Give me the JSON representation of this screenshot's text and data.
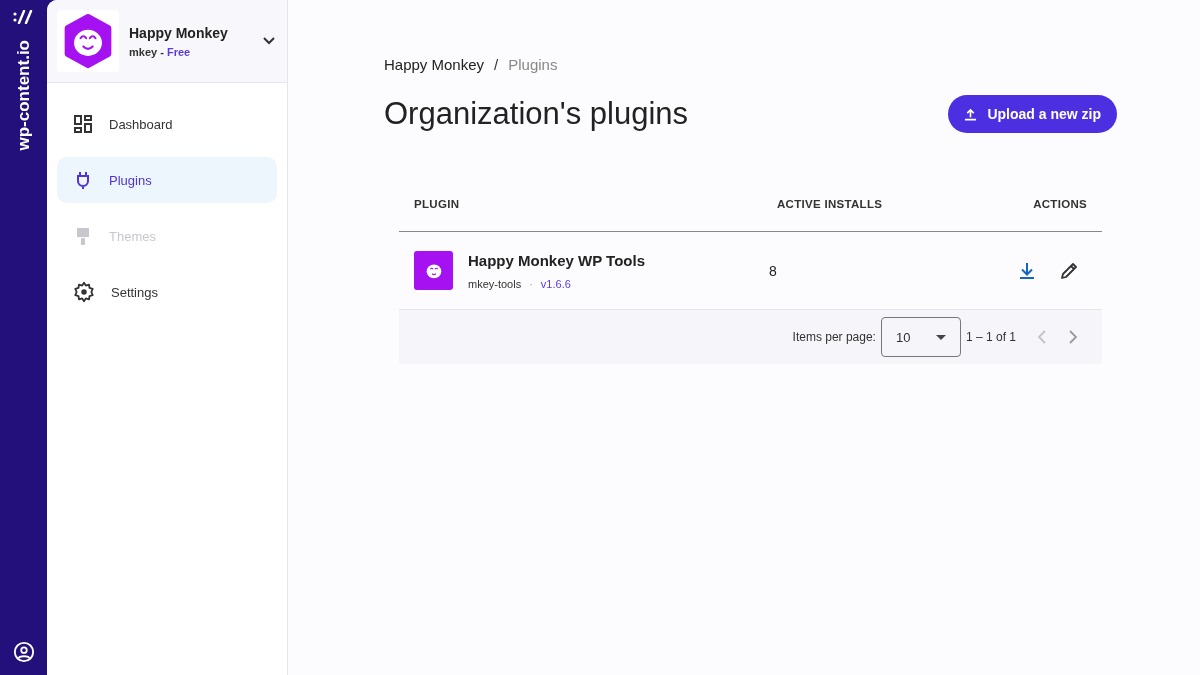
{
  "rail": {
    "brand": "wp-content.io"
  },
  "org": {
    "name": "Happy Monkey",
    "slug": "mkey",
    "separator": "-",
    "plan": "Free"
  },
  "nav": [
    {
      "label": "Dashboard",
      "kind": "dashboard",
      "selected": false,
      "disabled": false
    },
    {
      "label": "Plugins",
      "kind": "plugin",
      "selected": true,
      "disabled": false
    },
    {
      "label": "Themes",
      "kind": "theme",
      "selected": false,
      "disabled": true
    },
    {
      "label": "Settings",
      "kind": "settings",
      "selected": false,
      "disabled": false
    }
  ],
  "breadcrumb": [
    {
      "label": "Happy Monkey",
      "current": false
    },
    {
      "label": "Plugins",
      "current": true
    }
  ],
  "breadcrumb_separator": "/",
  "title": "Organization's plugins",
  "upload_button": "Upload a new zip",
  "table": {
    "columns": [
      "PLUGIN",
      "ACTIVE INSTALLS",
      "ACTIONS"
    ],
    "rows": [
      {
        "name": "Happy Monkey WP Tools",
        "slug": "mkey-tools",
        "dot": "·",
        "version": "v1.6.6",
        "installs": "8"
      }
    ]
  },
  "paginator": {
    "label": "Items per page:",
    "page_size": "10",
    "range": "1 – 1 of 1"
  }
}
